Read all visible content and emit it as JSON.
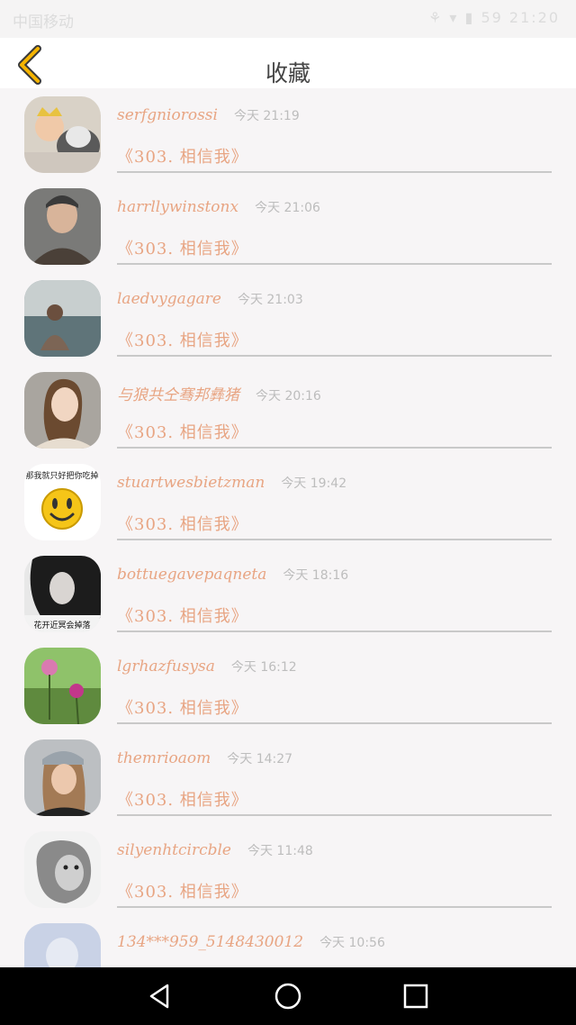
{
  "status_bar": {
    "carrier": "中国移动",
    "right": "⚘ ▾ ▮ 59 21:20"
  },
  "header": {
    "title": "收藏",
    "back_icon": "chevron-left-icon",
    "accent": "#f5b400"
  },
  "items": [
    {
      "name": "serfgniorossi",
      "time": "今天 21:19",
      "title": "《303. 相信我》"
    },
    {
      "name": "harrllywinstonx",
      "time": "今天 21:06",
      "title": "《303. 相信我》"
    },
    {
      "name": "laedvygagare",
      "time": "今天 21:03",
      "title": "《303. 相信我》"
    },
    {
      "name": "与狼共仝骞邦彝猪",
      "time": "今天 20:16",
      "title": "《303. 相信我》"
    },
    {
      "name": "stuartwesbietzman",
      "time": "今天 19:42",
      "title": "《303. 相信我》",
      "avatar_caption": "那我就只好把你吃掉"
    },
    {
      "name": "bottuegavepaqneta",
      "time": "今天 18:16",
      "title": "《303. 相信我》",
      "avatar_caption": "花开近冥会掉落"
    },
    {
      "name": "lgrhazfusysa",
      "time": "今天 16:12",
      "title": "《303. 相信我》"
    },
    {
      "name": "themrioaom",
      "time": "今天 14:27",
      "title": "《303. 相信我》"
    },
    {
      "name": "silyenhtcircble",
      "time": "今天 11:48",
      "title": "《303. 相信我》"
    },
    {
      "name": "134***959_5148430012",
      "time": "今天 10:56",
      "title": ""
    }
  ],
  "nav": {
    "back_icon": "triangle-back-icon",
    "home_icon": "circle-home-icon",
    "recents_icon": "square-recents-icon"
  }
}
